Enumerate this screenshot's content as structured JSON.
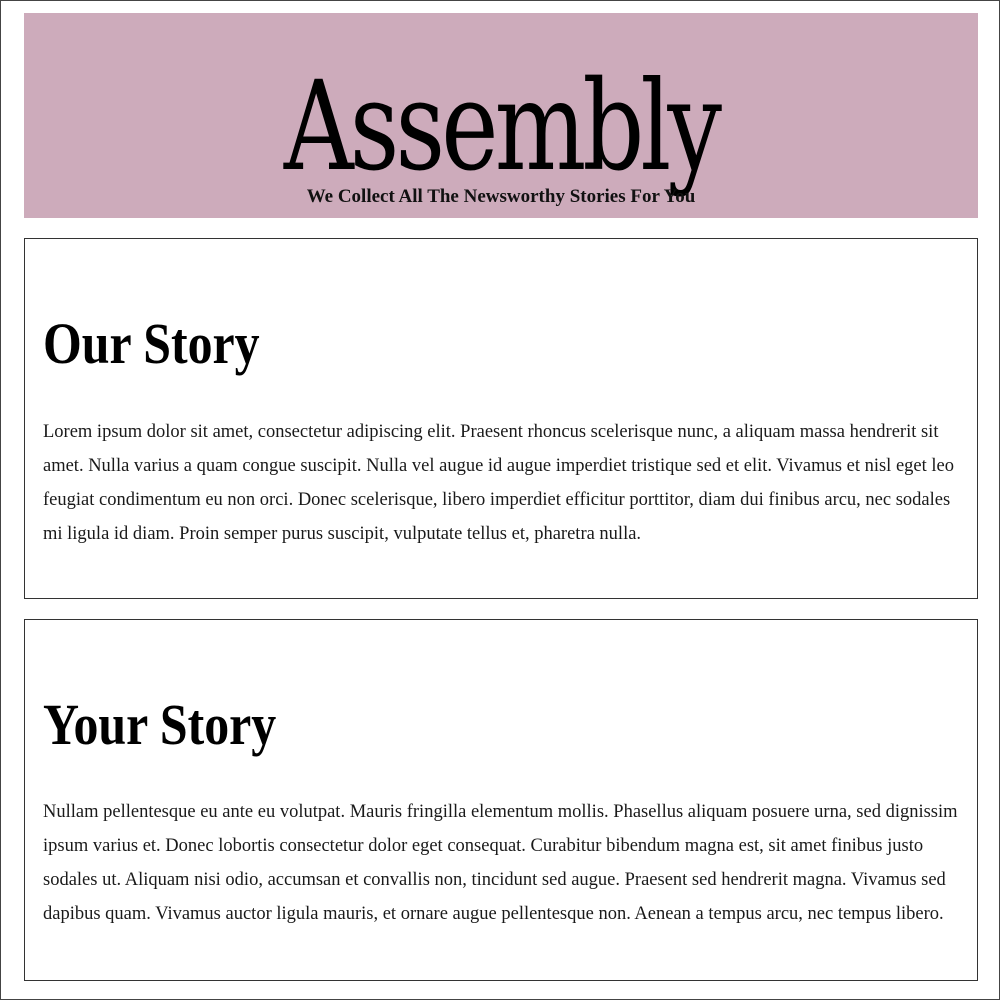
{
  "header": {
    "brand": "Assembly",
    "tagline": "We Collect All The Newsworthy Stories For You",
    "background_color": "#cdabbb"
  },
  "sections": [
    {
      "title": "Our Story",
      "body": "Lorem ipsum dolor sit amet, consectetur adipiscing elit. Praesent rhoncus scelerisque nunc, a aliquam massa hendrerit sit amet. Nulla varius a quam congue suscipit. Nulla vel augue id augue imperdiet tristique sed et elit. Vivamus et nisl eget leo feugiat condimentum eu non orci. Donec scelerisque, libero imperdiet efficitur porttitor, diam dui finibus arcu, nec sodales mi ligula id diam. Proin semper purus suscipit, vulputate tellus et, pharetra nulla."
    },
    {
      "title": "Your Story",
      "body": "Nullam pellentesque eu ante eu volutpat. Mauris fringilla elementum mollis. Phasellus aliquam posuere urna, sed dignissim ipsum varius et. Donec lobortis consectetur dolor eget consequat. Curabitur bibendum magna est, sit amet finibus justo sodales ut. Aliquam nisi odio, accumsan et convallis non, tincidunt sed augue. Praesent sed hendrerit magna. Vivamus sed dapibus quam. Vivamus auctor ligula mauris, et ornare augue pellentesque non. Aenean a tempus arcu, nec tempus libero."
    }
  ]
}
